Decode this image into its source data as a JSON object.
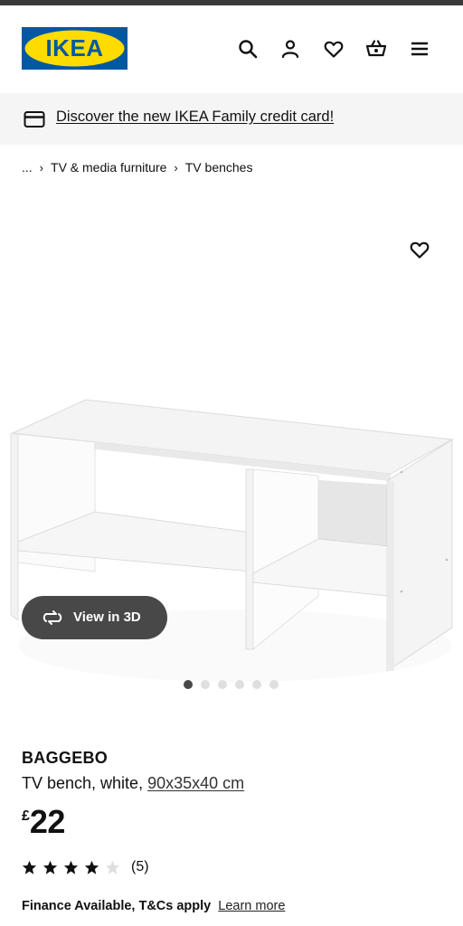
{
  "header": {
    "logo_text": "IKEA",
    "icons": [
      "search-icon",
      "user-icon",
      "heart-icon",
      "basket-icon",
      "menu-icon"
    ]
  },
  "promo": {
    "icon": "credit-card-icon",
    "text": "Discover the new IKEA Family credit card!"
  },
  "breadcrumb": {
    "items": [
      "...",
      "TV & media furniture",
      "TV benches"
    ],
    "separator": "›"
  },
  "media": {
    "favorite_icon": "heart-icon",
    "view3d_label": "View in 3D",
    "view3d_icon": "rotate-3d-icon",
    "carousel_count": 6,
    "carousel_active": 1
  },
  "product": {
    "name": "BAGGEBO",
    "description": "TV bench, white,",
    "dimensions": "90x35x40 cm",
    "currency": "£",
    "price": "22",
    "rating": 4,
    "rating_max": 5,
    "review_count": "(5)",
    "finance_text": "Finance Available, T&Cs apply",
    "finance_link": "Learn more"
  },
  "colors": {
    "ikea_blue": "#0058A3",
    "ikea_yellow": "#FFDB00",
    "button_dark": "#484848",
    "promo_bg": "#F5F5F5"
  }
}
